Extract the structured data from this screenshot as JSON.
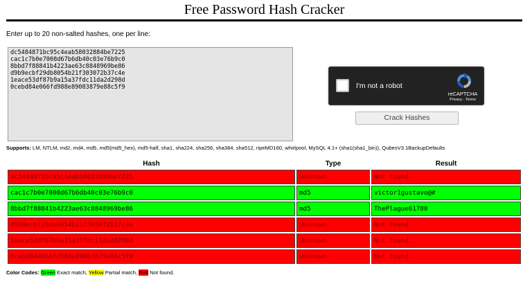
{
  "page": {
    "title": "Free Password Hash Cracker",
    "instructions": "Enter up to 20 non-salted hashes, one per line:"
  },
  "input": {
    "textarea_value": "dc5484871bc95c4eab58032884be7225\ncac1c7b0e7008d67b6db40c03e76b9c0\n8bbd7f88841b4223ae63c8848969be86\nd9b9ecbf29db8054b21f303072b37c4e\n1eace53df87b9a15a37fdc11da2d298d\n0cebd84e066fd988e89083879e88c5f9"
  },
  "recaptcha": {
    "label": "I'm not a robot",
    "brand": "reCAPTCHA",
    "links": "Privacy - Terms"
  },
  "actions": {
    "crack_label": "Crack Hashes"
  },
  "supports": {
    "label": "Supports:",
    "text": " LM, NTLM, md2, md4, md5, md5(md5_hex), md5-half, sha1, sha224, sha256, sha384, sha512, ripeMD160, whirlpool, MySQL 4.1+ (sha1(sha1_bin)), QubesV3.1BackupDefaults"
  },
  "results": {
    "headers": [
      "Hash",
      "Type",
      "Result"
    ],
    "rows": [
      {
        "hash": "dc5484871bc95c4eab58032884be7225",
        "type": "Unknown",
        "result": "Not found.",
        "status": "notfound"
      },
      {
        "hash": "cac1c7b0e7008d67b6db40c03e76b9c0",
        "type": "md5",
        "result": "victor1gustavo@#",
        "status": "found"
      },
      {
        "hash": "8bbd7f88841b4223ae63c8848969be86",
        "type": "md5",
        "result": "ThePlague61780",
        "status": "found"
      },
      {
        "hash": "d9b9ecbf29db8054b21f303072b37c4e",
        "type": "Unknown",
        "result": "Not found.",
        "status": "notfound"
      },
      {
        "hash": "1eace53df87b9a15a37fdc11da2d298d",
        "type": "Unknown",
        "result": "Not found.",
        "status": "notfound"
      },
      {
        "hash": "0cebd84e066fd988e89083879e88c5f9",
        "type": "Unknown",
        "result": "Not found.",
        "status": "notfound"
      }
    ]
  },
  "legend": {
    "label": "Color Codes:",
    "green": "Green",
    "green_text": " Exact match, ",
    "yellow": "Yellow",
    "yellow_text": " Partial match, ",
    "red": "Red",
    "red_text": " Not found."
  },
  "colors": {
    "found": "#00ff00",
    "partial": "#ffff00",
    "not_found": "#ff0000",
    "recaptcha_bg": "#222222"
  },
  "icons": {
    "recaptcha_logo": "recaptcha-logo-icon"
  }
}
